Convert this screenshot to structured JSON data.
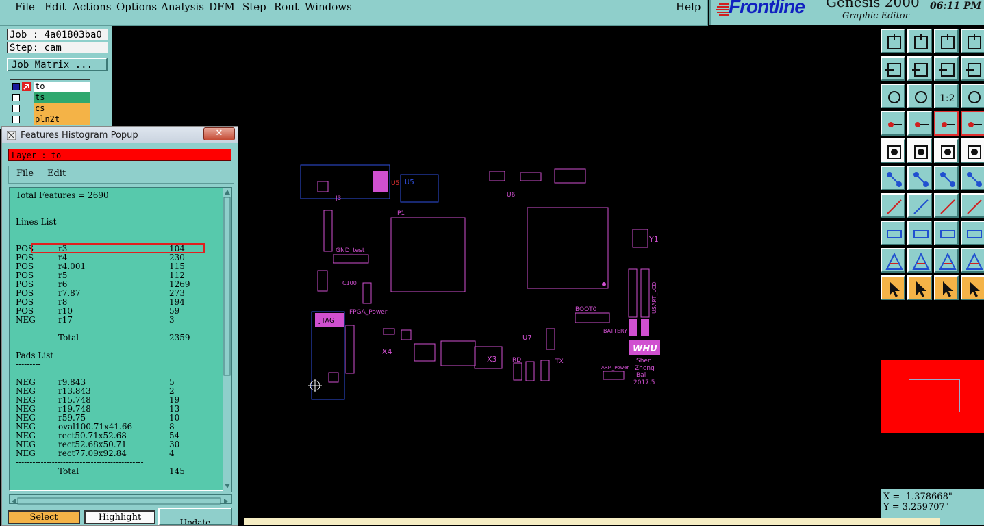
{
  "menu": {
    "items": [
      "File",
      "Edit",
      "Actions",
      "Options",
      "Analysis",
      "DFM",
      "Step",
      "Rout",
      "Windows"
    ],
    "help": "Help"
  },
  "brand": {
    "logo": "Frontline",
    "product": "Genesis 2000",
    "subtitle": "Graphic Editor",
    "clock": "06:11 PM"
  },
  "job": {
    "job_label": "Job : 4a01803ba0",
    "step_label": "Step: cam",
    "matrix_button": "Job Matrix ..."
  },
  "layers": [
    {
      "name": "to",
      "color": "#ffffff"
    },
    {
      "name": "ts",
      "color": "#2fa86e"
    },
    {
      "name": "cs",
      "color": "#f4b347"
    },
    {
      "name": "pln2t",
      "color": "#f4b347"
    }
  ],
  "popup": {
    "title": "Features Histogram Popup",
    "layer_bar": "Layer :  to",
    "menu": [
      "File",
      "Edit"
    ],
    "total_features": "Total Features = 2690",
    "lines_heading": "Lines List",
    "lines_rule": "----------",
    "lines": [
      {
        "pol": "POS",
        "sym": "r3",
        "count": "104"
      },
      {
        "pol": "POS",
        "sym": "r4",
        "count": "230"
      },
      {
        "pol": "POS",
        "sym": "r4.001",
        "count": "115"
      },
      {
        "pol": "POS",
        "sym": "r5",
        "count": "112"
      },
      {
        "pol": "POS",
        "sym": "r6",
        "count": "1269"
      },
      {
        "pol": "POS",
        "sym": "r7.87",
        "count": "273"
      },
      {
        "pol": "POS",
        "sym": "r8",
        "count": "194"
      },
      {
        "pol": "POS",
        "sym": "r10",
        "count": "59"
      },
      {
        "pol": "NEG",
        "sym": "r17",
        "count": "3"
      }
    ],
    "divider": "----------------------------------------------",
    "lines_total_label": "Total",
    "lines_total": "2359",
    "pads_heading": "Pads List",
    "pads_rule": "---------",
    "pads": [
      {
        "pol": "NEG",
        "sym": "r9.843",
        "count": "5"
      },
      {
        "pol": "NEG",
        "sym": "r13.843",
        "count": "2"
      },
      {
        "pol": "NEG",
        "sym": "r15.748",
        "count": "19"
      },
      {
        "pol": "NEG",
        "sym": "r19.748",
        "count": "13"
      },
      {
        "pol": "NEG",
        "sym": "r59.75",
        "count": "10"
      },
      {
        "pol": "NEG",
        "sym": "oval100.71x41.66",
        "count": "8"
      },
      {
        "pol": "NEG",
        "sym": "rect50.71x52.68",
        "count": "54"
      },
      {
        "pol": "NEG",
        "sym": "rect52.68x50.71",
        "count": "30"
      },
      {
        "pol": "NEG",
        "sym": "rect77.09x92.84",
        "count": "4"
      }
    ],
    "pads_total_label": "Total",
    "pads_total": "145",
    "buttons": {
      "select": "Select",
      "highlight": "Highlight",
      "update": "Update"
    }
  },
  "board_labels": {
    "p1": "P1",
    "j3": "J3",
    "u5": "U5",
    "u6": "U6",
    "gnd": "GND_test",
    "fpga_power": "FPGA_Power",
    "jtag": "JTAG",
    "boot": "BOOT0",
    "battery": "BATTERY",
    "whu": "WHU",
    "shen": "Shen",
    "zheng": "Zheng",
    "bai": "Bai",
    "year": "2017.5",
    "y1": "Y1",
    "x3": "X3",
    "x4": "X4",
    "u7": "U7",
    "rd": "RD",
    "tx": "TX",
    "arm_power": "ARM_Power",
    "c100": "C100",
    "usart": "USART_LCD"
  },
  "toolbar_icons": [
    "zoom-home-icon",
    "zoom-fit-icon",
    "house-icon",
    "split-view-icon",
    "pan-left-icon",
    "pan-right-icon",
    "zoom-ratio-icon",
    "zoom-s-icon",
    "zoom-in-icon",
    "zoom-center-icon",
    "ratio-1-2-icon",
    "help-question-icon",
    "measure-tool-icon",
    "probe-icon",
    "layer-red-blue-icon",
    "layer-compare-icon",
    "snap-pad-icon",
    "select-box-icon",
    "ruler-icon",
    "dot-icon",
    "node-graph-icon",
    "cross-icon",
    "arrow-node-icon",
    "arrow-node-blue-icon",
    "line-red-icon",
    "line-blue-icon",
    "rotate-arc-icon",
    "dimension-icon",
    "box-dot-icon",
    "dash-line-icon",
    "span-icon",
    "ellipse-icon",
    "triangle-a-icon",
    "triangle-a2-icon",
    "triangle-a3-icon",
    "triangle-a4-icon",
    "cursor-arrow-icon",
    "cursor-box-icon",
    "cursor-circle-icon",
    "cursor-link-icon"
  ],
  "coords": {
    "x": "X = -1.378668\"",
    "y": "Y = 3.259707\""
  }
}
